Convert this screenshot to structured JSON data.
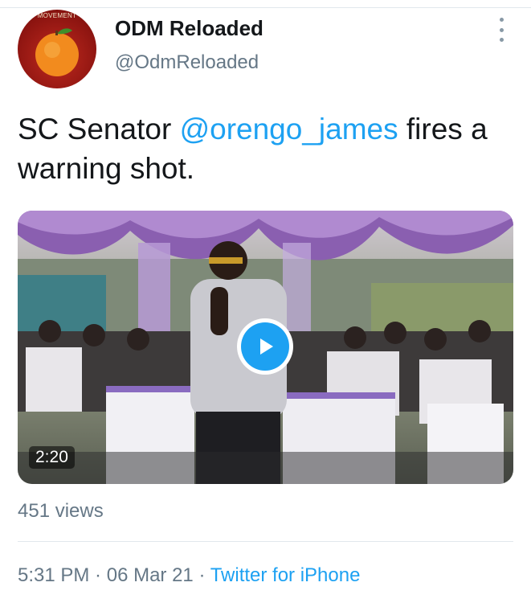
{
  "author": {
    "display_name": "ODM Reloaded",
    "handle": "@OdmReloaded",
    "avatar_text": "MOVEMENT"
  },
  "tweet": {
    "text_before": "SC Senator ",
    "mention": "@orengo_james",
    "text_after": " fires a warning shot."
  },
  "media": {
    "duration": "2:20"
  },
  "stats": {
    "views": "451 views"
  },
  "meta": {
    "time": "5:31 PM",
    "separator": " · ",
    "date": "06 Mar 21",
    "source": "Twitter for iPhone"
  },
  "colors": {
    "accent": "#1da1f2",
    "secondary_text": "#657786",
    "avatar_bg": "#8c1410"
  },
  "icons": {
    "more": "more-vertical-icon",
    "play": "play-icon"
  }
}
